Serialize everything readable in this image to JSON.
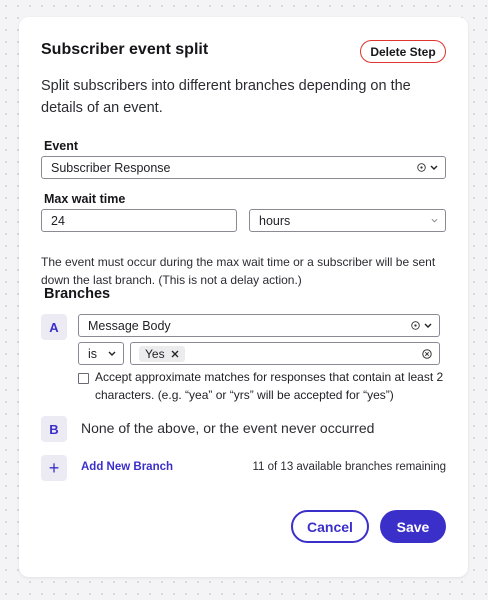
{
  "panel": {
    "title": "Subscriber event split",
    "delete_label": "Delete Step",
    "description": "Split subscribers into different branches depending on the details of an event."
  },
  "event": {
    "label": "Event",
    "value": "Subscriber Response"
  },
  "max_wait": {
    "label": "Max wait time",
    "value": "24",
    "unit": "hours",
    "help": "The event must occur during the max wait time or a subscriber will be sent down the last branch. (This is not a delay action.)"
  },
  "branches": {
    "title": "Branches",
    "a": {
      "letter": "A",
      "field": "Message Body",
      "operator": "is",
      "chip": "Yes",
      "checkbox_label": "Accept approximate matches for responses that contain at least 2 characters. (e.g. “yea” or “yrs” will be accepted for “yes”)",
      "checked": false
    },
    "b": {
      "letter": "B",
      "text": "None of the above, or the event never occurred"
    },
    "add_label": "Add New Branch",
    "add_icon": "+",
    "remaining": "11 of 13 available branches remaining"
  },
  "footer": {
    "cancel_label": "Cancel",
    "save_label": "Save"
  },
  "colors": {
    "accent": "#3b2fc9",
    "danger_border": "#e0352f",
    "badge_bg": "#ecebf3"
  }
}
